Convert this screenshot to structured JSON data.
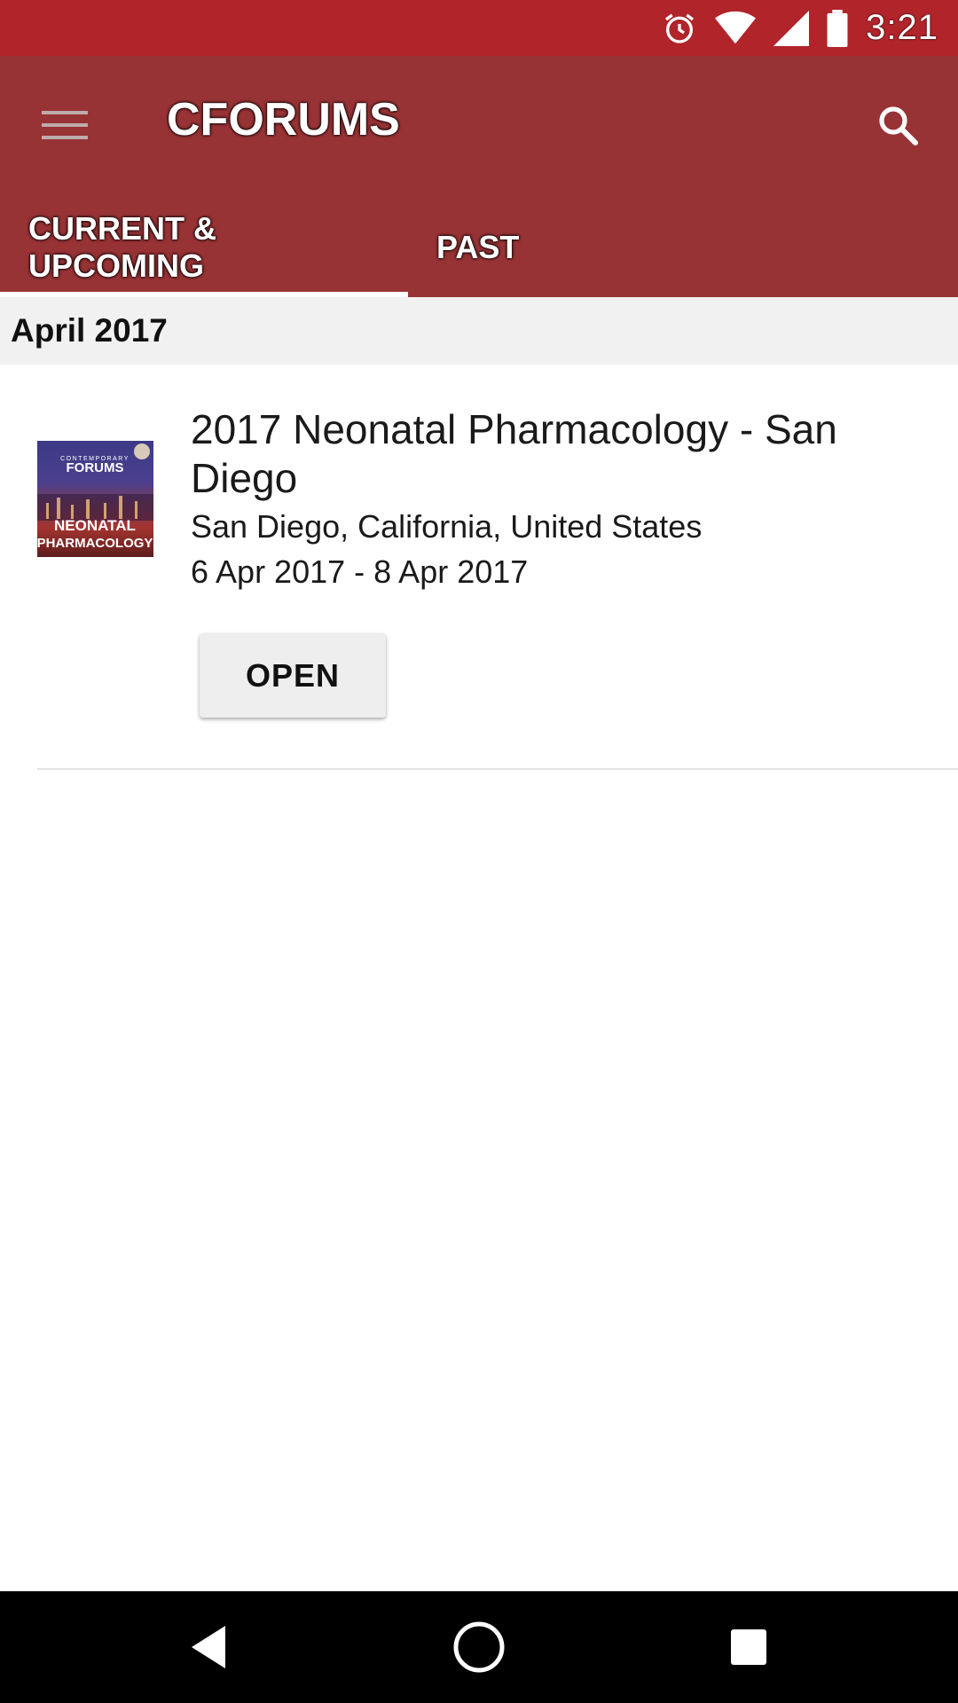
{
  "status_bar": {
    "time": "3:21",
    "icons": [
      "alarm-icon",
      "wifi-icon",
      "signal-icon",
      "battery-icon"
    ]
  },
  "app_bar": {
    "title": "CFORUMS",
    "menu_icon": "hamburger-menu-icon",
    "search_icon": "search-icon",
    "color": "#973235"
  },
  "tabs": [
    {
      "label": "CURRENT & UPCOMING",
      "active": true
    },
    {
      "label": "PAST",
      "active": false
    }
  ],
  "sections": [
    {
      "header": "April 2017",
      "events": [
        {
          "title": "2017 Neonatal Pharmacology - San Diego",
          "location": "San Diego, California, United States",
          "dates": "6 Apr 2017 - 8 Apr 2017",
          "action_label": "OPEN",
          "thumbnail": {
            "brand_top": "CONTEMPORARY",
            "brand": "FORUMS",
            "line1": "NEONATAL",
            "line2": "PHARMACOLOGY"
          }
        }
      ]
    }
  ],
  "nav_bar": {
    "icons": [
      "back-icon",
      "home-icon",
      "recents-icon"
    ]
  },
  "colors": {
    "status_bar": "#b0242a",
    "app_bar": "#973235",
    "section_header_bg": "#f1f1f1"
  }
}
